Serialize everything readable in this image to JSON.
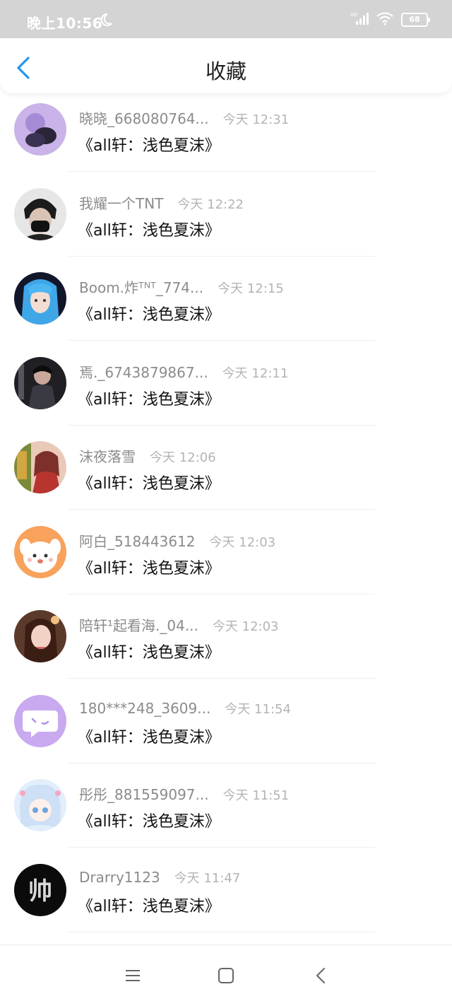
{
  "status_bar": {
    "time": "晚上10:56",
    "battery": "68",
    "network_label": "HD"
  },
  "header": {
    "title": "收藏",
    "back_icon": "chevron-left-icon"
  },
  "colors": {
    "accent": "#2196F3",
    "status_bar_bg": "#d4d4d4",
    "username": "#8b8b8b",
    "timestamp": "#b4b4b4"
  },
  "items": [
    {
      "username": "晓晓_668080764...",
      "time": "今天 12:31",
      "title": "《all轩：浅色夏沫》"
    },
    {
      "username": "我耀一个TNT",
      "time": "今天 12:22",
      "title": "《all轩：浅色夏沫》"
    },
    {
      "username": "Boom.炸ᵀᴺᵀ_774...",
      "time": "今天 12:15",
      "title": "《all轩：浅色夏沫》"
    },
    {
      "username": "焉._6743879867...",
      "time": "今天 12:11",
      "title": "《all轩：浅色夏沫》"
    },
    {
      "username": "沫夜落雪",
      "time": "今天 12:06",
      "title": "《all轩：浅色夏沫》"
    },
    {
      "username": "阿白_518443612",
      "time": "今天 12:03",
      "title": "《all轩：浅色夏沫》"
    },
    {
      "username": "陪轩¹起看海._04...",
      "time": "今天 12:03",
      "title": "《all轩：浅色夏沫》"
    },
    {
      "username": "180***248_3609...",
      "time": "今天 11:54",
      "title": "《all轩：浅色夏沫》"
    },
    {
      "username": "彤彤_881559097...",
      "time": "今天 11:51",
      "title": "《all轩：浅色夏沫》"
    },
    {
      "username": "Drarry1123",
      "time": "今天 11:47",
      "title": "《all轩：浅色夏沫》"
    }
  ],
  "nav_bar": {
    "menu_icon": "menu-icon",
    "home_icon": "home-square-icon",
    "back_icon": "back-triangle-icon"
  }
}
